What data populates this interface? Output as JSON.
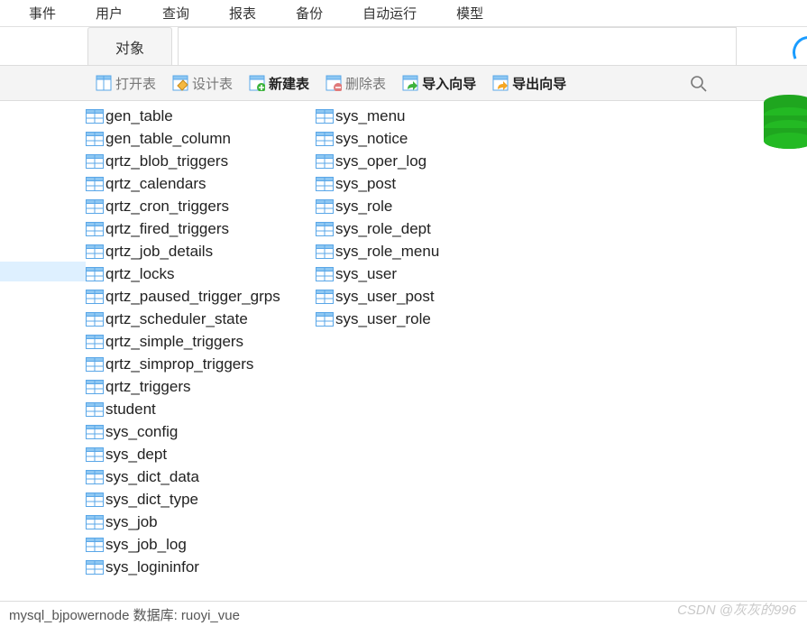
{
  "menubar": [
    "事件",
    "用户",
    "查询",
    "报表",
    "备份",
    "自动运行",
    "模型"
  ],
  "tab_object": "对象",
  "toolbar": {
    "open_table": "打开表",
    "design_table": "设计表",
    "new_table": "新建表",
    "delete_table": "删除表",
    "import_wizard": "导入向导",
    "export_wizard": "导出向导"
  },
  "tables_col1": [
    "gen_table",
    "gen_table_column",
    "qrtz_blob_triggers",
    "qrtz_calendars",
    "qrtz_cron_triggers",
    "qrtz_fired_triggers",
    "qrtz_job_details",
    "qrtz_locks",
    "qrtz_paused_trigger_grps",
    "qrtz_scheduler_state",
    "qrtz_simple_triggers",
    "qrtz_simprop_triggers",
    "qrtz_triggers",
    "student",
    "sys_config",
    "sys_dept",
    "sys_dict_data",
    "sys_dict_type",
    "sys_job",
    "sys_job_log",
    "sys_logininfor"
  ],
  "tables_col2": [
    "sys_menu",
    "sys_notice",
    "sys_oper_log",
    "sys_post",
    "sys_role",
    "sys_role_dept",
    "sys_role_menu",
    "sys_user",
    "sys_user_post",
    "sys_user_role"
  ],
  "statusbar": "mysql_bjpowernode   数据库: ruoyi_vue",
  "watermark": "CSDN @灰灰的996"
}
